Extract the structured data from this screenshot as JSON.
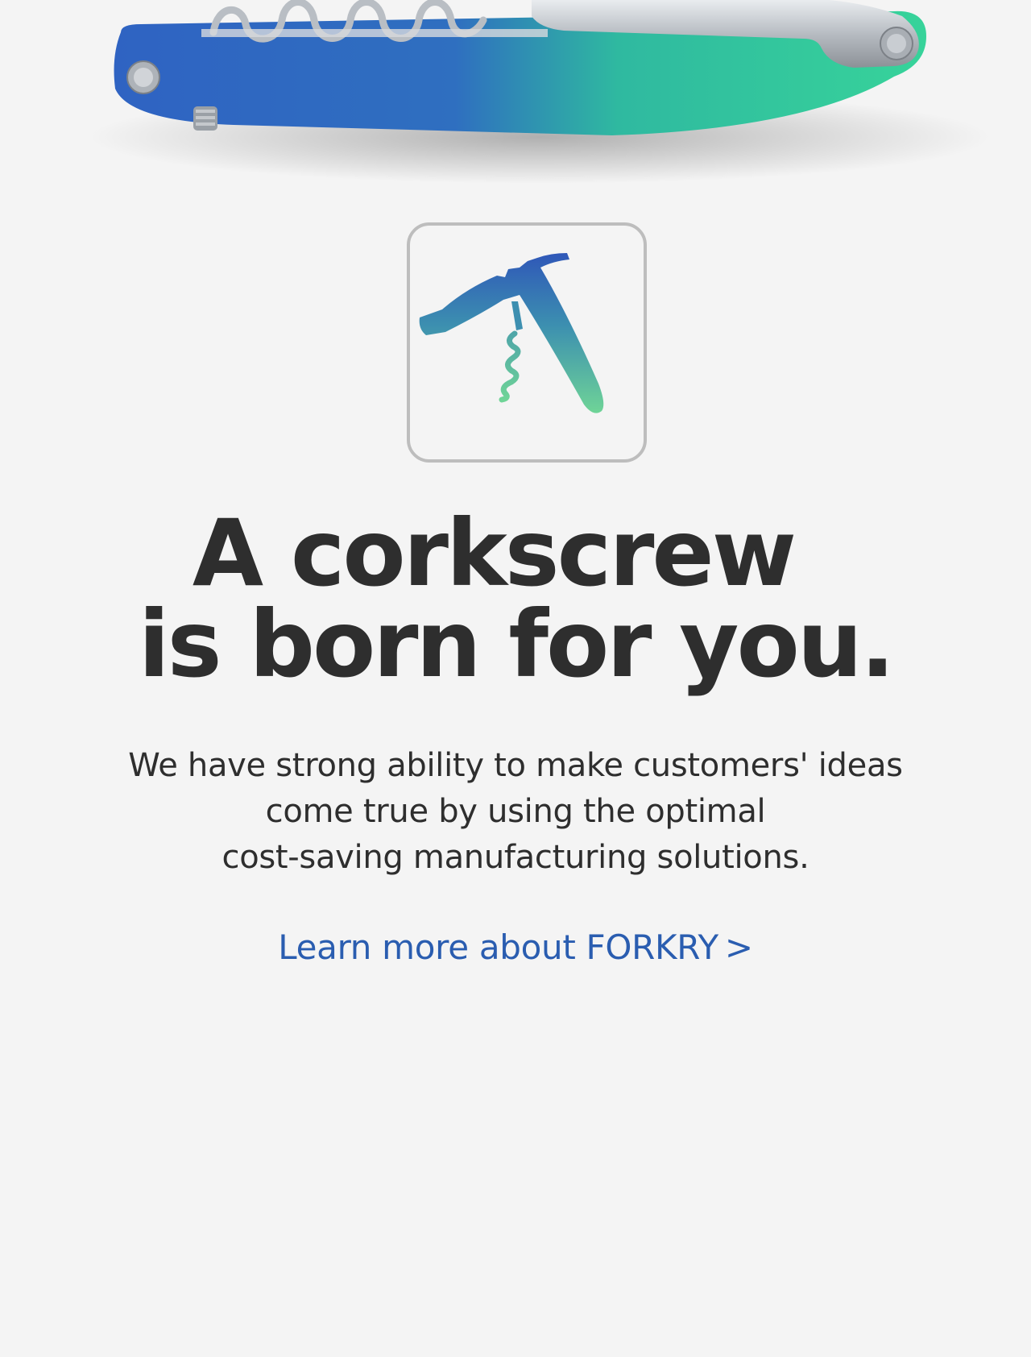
{
  "hero": {
    "image": "corkscrew-product-photo",
    "accent_start": "#2f63c2",
    "accent_end": "#37d39a"
  },
  "logo": {
    "icon": "corkscrew-logo-icon",
    "gradient_start": "#2f57b8",
    "gradient_end": "#6fd497"
  },
  "headline": {
    "line_1": "A corkscrew",
    "line_2": "is born for you."
  },
  "description": {
    "line_1": "We have strong ability to make customers' ideas",
    "line_2": "come true by using the optimal",
    "line_3": "cost-saving manufacturing solutions."
  },
  "learn_more": {
    "label": "Learn more about FORKRY",
    "chevron": ">",
    "color": "#2a5db0"
  }
}
